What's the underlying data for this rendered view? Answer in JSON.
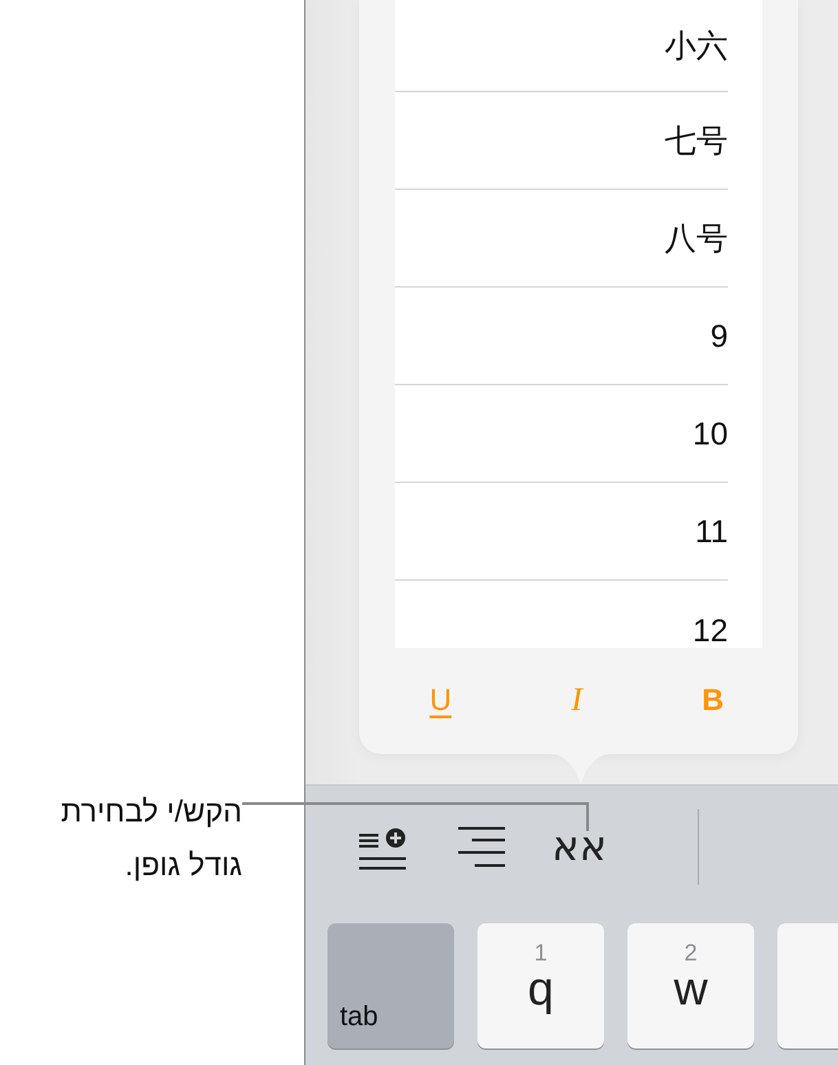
{
  "callout": {
    "text": "הקש/י לבחירת גודל גופן."
  },
  "font_size_popover": {
    "sizes": [
      {
        "label": "小六"
      },
      {
        "label": "七号"
      },
      {
        "label": "八号"
      },
      {
        "label": "9"
      },
      {
        "label": "10"
      },
      {
        "label": "11"
      },
      {
        "label": "12"
      }
    ],
    "format_buttons": [
      {
        "kind": "bold",
        "label": "B"
      },
      {
        "kind": "italic",
        "label": "I"
      },
      {
        "kind": "underline",
        "label": "U"
      }
    ]
  },
  "toolbar": {
    "font_size_button": "אא"
  },
  "keyboard": {
    "keys": [
      {
        "kind": "letter"
      },
      {
        "kind": "letter",
        "hint": "2",
        "label": "w"
      },
      {
        "kind": "letter",
        "hint": "1",
        "label": "q"
      },
      {
        "kind": "function",
        "label": "tab"
      }
    ]
  }
}
